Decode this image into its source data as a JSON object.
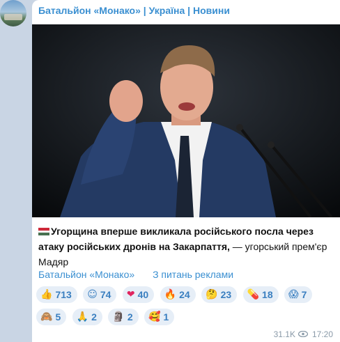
{
  "channel": {
    "name": "Батальйон «Монако» | Україна | Новини"
  },
  "post": {
    "caption_bold": "Угорщина вперше викликала російського посла через атаку російських дронів на Закарпаття,",
    "caption_rest": " — угорський прем'єр Мадяр",
    "flag_colors": [
      "#ce2939",
      "#ffffff",
      "#477050"
    ]
  },
  "buttons": [
    {
      "label": "Батальйон «Монако»"
    },
    {
      "label": "З питань реклами"
    }
  ],
  "reactions": [
    {
      "icon": "thumbs-up",
      "glyph": "👍",
      "count": "713"
    },
    {
      "icon": "smiling-face",
      "glyph": "☺",
      "count": "74"
    },
    {
      "icon": "heart-on-fire",
      "glyph": "❤",
      "count": "40"
    },
    {
      "icon": "fire",
      "glyph": "🔥",
      "count": "24"
    },
    {
      "icon": "thinking-face",
      "glyph": "🤔",
      "count": "23"
    },
    {
      "icon": "pill",
      "glyph": "💊",
      "count": "18"
    },
    {
      "icon": "screaming-face",
      "glyph": "😱",
      "count": "7"
    },
    {
      "icon": "see-no-evil-monkey",
      "glyph": "🙈",
      "count": "5"
    },
    {
      "icon": "folded-hands",
      "glyph": "🙏",
      "count": "2"
    },
    {
      "icon": "moai",
      "glyph": "🗿",
      "count": "2"
    },
    {
      "icon": "smiling-face-with-hearts",
      "glyph": "🥰",
      "count": "1"
    }
  ],
  "meta": {
    "views": "31.1K",
    "time": "17:20"
  },
  "colors": {
    "accent": "#3a8fd1",
    "reaction_bg": "#e6eef7",
    "background": "#c9d5e4"
  }
}
